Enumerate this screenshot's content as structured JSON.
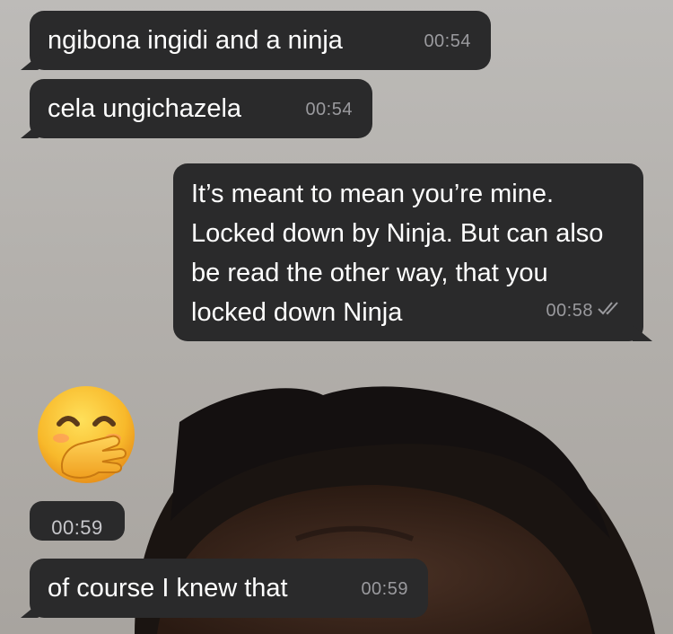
{
  "messages": [
    {
      "text": "ngibona ingidi and a ninja",
      "time": "00:54",
      "direction": "incoming"
    },
    {
      "text": "cela ungichazela",
      "time": "00:54",
      "direction": "incoming"
    },
    {
      "text": "It’s meant to mean you’re mine. Locked down by Ninja. But can also be read the other way, that you locked down Ninja",
      "time": "00:58",
      "direction": "outgoing",
      "status": "read"
    },
    {
      "emoji": "hand-over-mouth-emoji",
      "time": "00:59",
      "direction": "incoming"
    },
    {
      "text": "of course I knew that",
      "time": "00:59",
      "direction": "incoming"
    }
  ],
  "colors": {
    "bubble": "#2a2a2b",
    "text": "#ffffff",
    "timestamp": "#9a9a9e"
  }
}
